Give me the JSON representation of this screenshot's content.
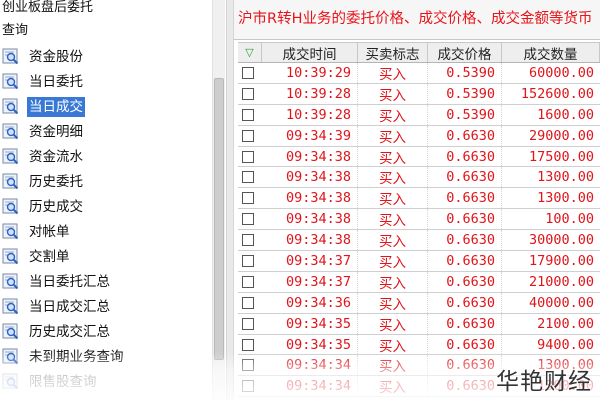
{
  "sidebar": {
    "header_lines": [
      "创业板盘后委托",
      "查询"
    ],
    "items": [
      {
        "label": "资金股份",
        "icon": "magnifier-doc-icon"
      },
      {
        "label": "当日委托",
        "icon": "magnifier-doc-icon"
      },
      {
        "label": "当日成交",
        "icon": "magnifier-doc-icon",
        "selected": true
      },
      {
        "label": "资金明细",
        "icon": "magnifier-doc-icon"
      },
      {
        "label": "资金流水",
        "icon": "magnifier-doc-icon"
      },
      {
        "label": "历史委托",
        "icon": "magnifier-doc-icon"
      },
      {
        "label": "历史成交",
        "icon": "magnifier-doc-icon"
      },
      {
        "label": "对帐单",
        "icon": "magnifier-doc-icon"
      },
      {
        "label": "交割单",
        "icon": "magnifier-doc-icon"
      },
      {
        "label": "当日委托汇总",
        "icon": "magnifier-doc-icon"
      },
      {
        "label": "当日成交汇总",
        "icon": "magnifier-doc-icon"
      },
      {
        "label": "历史成交汇总",
        "icon": "magnifier-doc-icon"
      },
      {
        "label": "未到期业务查询",
        "icon": "magnifier-doc-icon"
      },
      {
        "label": "限售股查询",
        "icon": "magnifier-doc-icon",
        "faded": true
      }
    ]
  },
  "notice": "沪市R转H业务的委托价格、成交价格、成交金额等货币",
  "table": {
    "sort_indicator": "▽",
    "columns": [
      "成交时间",
      "买卖标志",
      "成交价格",
      "成交数量"
    ],
    "rows": [
      [
        "10:39:29",
        "买入",
        "0.5390",
        "60000.00"
      ],
      [
        "10:39:28",
        "买入",
        "0.5390",
        "152600.00"
      ],
      [
        "10:39:28",
        "买入",
        "0.5390",
        "1600.00"
      ],
      [
        "09:34:39",
        "买入",
        "0.6630",
        "29000.00"
      ],
      [
        "09:34:38",
        "买入",
        "0.6630",
        "17500.00"
      ],
      [
        "09:34:38",
        "买入",
        "0.6630",
        "1300.00"
      ],
      [
        "09:34:38",
        "买入",
        "0.6630",
        "1300.00"
      ],
      [
        "09:34:38",
        "买入",
        "0.6630",
        "100.00"
      ],
      [
        "09:34:38",
        "买入",
        "0.6630",
        "30000.00"
      ],
      [
        "09:34:37",
        "买入",
        "0.6630",
        "17900.00"
      ],
      [
        "09:34:37",
        "买入",
        "0.6630",
        "21000.00"
      ],
      [
        "09:34:36",
        "买入",
        "0.6630",
        "40000.00"
      ],
      [
        "09:34:35",
        "买入",
        "0.6630",
        "2100.00"
      ],
      [
        "09:34:35",
        "买入",
        "0.6630",
        "9400.00"
      ],
      [
        "09:34:34",
        "买入",
        "0.6630",
        "1300.00"
      ],
      [
        "09:34:34",
        "买入",
        "0.6630",
        "1300.00"
      ]
    ]
  },
  "watermark": "华艳财经",
  "colors": {
    "trade_text": "#e0141a",
    "selection": "#3a78d6",
    "sort_indicator": "#2e9a2e"
  }
}
